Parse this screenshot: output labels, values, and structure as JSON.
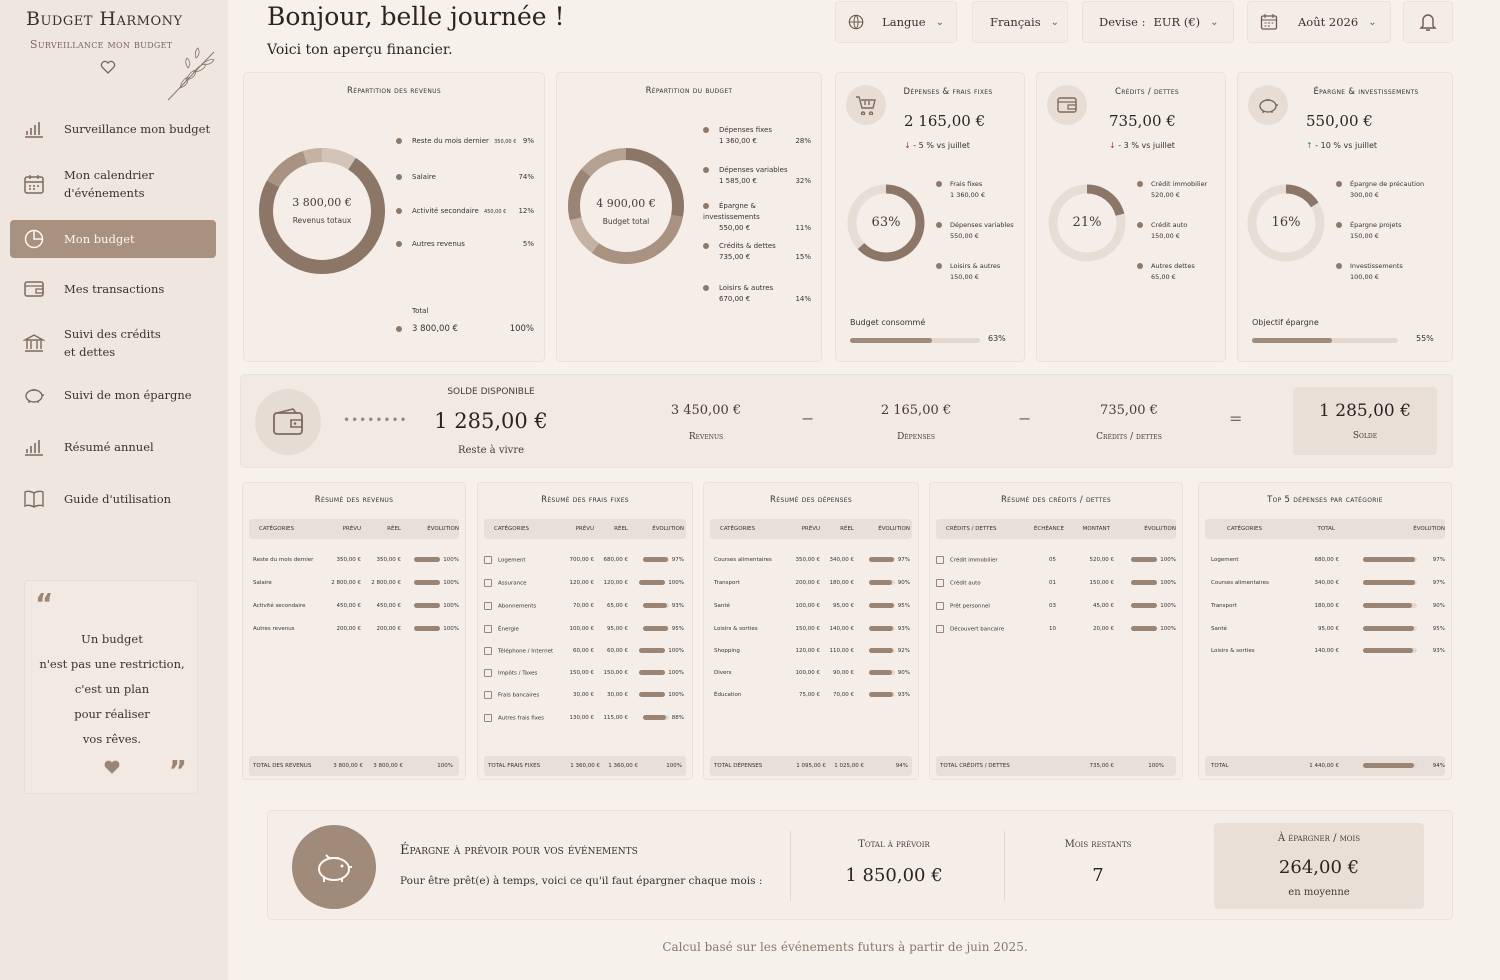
{
  "brand": {
    "title": "Budget Harmony",
    "subtitle": "Surveillance mon budget"
  },
  "nav": [
    {
      "label": "Surveillance mon budget",
      "icon": "chart-bars-icon"
    },
    {
      "label": "Mon calendrier\nd'événements",
      "icon": "calendar-icon"
    },
    {
      "label": "Mon budget",
      "icon": "pie-chart-icon",
      "active": true
    },
    {
      "label": "Mes transactions",
      "icon": "wallet-icon"
    },
    {
      "label": "Suivi des crédits\net dettes",
      "icon": "bank-icon"
    },
    {
      "label": "Suivi de mon épargne",
      "icon": "piggy-bank-icon"
    },
    {
      "label": "Résumé annuel",
      "icon": "chart-bars-icon"
    },
    {
      "label": "Guide d'utilisation",
      "icon": "book-icon"
    }
  ],
  "quote": {
    "lines": [
      "Un budget",
      "n'est pas une restriction,",
      "c'est un plan",
      "pour réaliser",
      "vos rêves."
    ]
  },
  "header": {
    "greeting": "Bonjour, belle journée !",
    "subtitle": "Voici ton aperçu financier.",
    "language": "Langue",
    "locale": "Français",
    "currency_label": "Devise :",
    "currency": "EUR (€)",
    "month": "Août 2026"
  },
  "cards": {
    "revenus": {
      "title": "Répartition des revenus",
      "center_amount": "3 800,00 €",
      "center_label": "Revenus totaux",
      "items": [
        {
          "label": "Reste du mois dernier",
          "amount": "350,00 €",
          "pct": "9%"
        },
        {
          "label": "Salaire",
          "amount": "",
          "pct": "74%"
        },
        {
          "label": "Activité secondaire",
          "amount": "450,00 €",
          "pct": "12%"
        },
        {
          "label": "Autres revenus",
          "amount": "",
          "pct": "5%"
        }
      ],
      "total_label": "Total",
      "total_amount": "3 800,00 €",
      "total_pct": "100%"
    },
    "budget": {
      "title": "Répartition du budget",
      "center_amount": "4 900,00 €",
      "center_label": "Budget total",
      "items": [
        {
          "label": "Dépenses fixes",
          "amount": "1 360,00 €",
          "pct": "28%"
        },
        {
          "label": "Dépenses variables",
          "amount": "1 585,00 €",
          "pct": "32%"
        },
        {
          "label": "Épargne & investissements",
          "amount": "550,00 €",
          "pct": "11%"
        },
        {
          "label": "Crédits & dettes",
          "amount": "735,00 €",
          "pct": "15%"
        },
        {
          "label": "Loisirs & autres",
          "amount": "670,00 €",
          "pct": "14%"
        }
      ]
    },
    "depenses": {
      "title": "Dépenses & frais fixes",
      "amount": "2 165,00 €",
      "delta": "- 5 % vs juillet",
      "donut": "63%",
      "donut_value": 63,
      "items": [
        {
          "label": "Frais fixes",
          "amount": "1 360,00 €"
        },
        {
          "label": "Dépenses variables",
          "amount": "550,00 €"
        },
        {
          "label": "Loisirs & autres",
          "amount": "150,00 €"
        }
      ],
      "progress_label": "Budget consommé",
      "progress_pct": "63%",
      "progress_value": 63
    },
    "credits": {
      "title": "Crédits / dettes",
      "amount": "735,00 €",
      "delta": "- 3 % vs juillet",
      "donut": "21%",
      "donut_value": 21,
      "items": [
        {
          "label": "Crédit immobilier",
          "amount": "520,00 €"
        },
        {
          "label": "Crédit auto",
          "amount": "150,00 €"
        },
        {
          "label": "Autres dettes",
          "amount": "65,00 €"
        }
      ]
    },
    "epargne": {
      "title": "Épargne & investissements",
      "amount": "550,00 €",
      "delta": "- 10 % vs juillet",
      "donut": "16%",
      "donut_value": 16,
      "items": [
        {
          "label": "Épargne de précaution",
          "amount": "300,00 €"
        },
        {
          "label": "Épargne projets",
          "amount": "150,00 €"
        },
        {
          "label": "Investissements",
          "amount": "100,00 €"
        }
      ],
      "progress_label": "Objectif épargne",
      "progress_pct": "55%",
      "progress_value": 55
    }
  },
  "solde": {
    "title": "Solde disponible",
    "amount": "1 285,00 €",
    "label": "Reste à vivre",
    "dots": "••••••••",
    "revenus_amount": "3 450,00 €",
    "revenus_label": "Revenus",
    "depenses_amount": "2 165,00 €",
    "depenses_label": "Dépenses",
    "credits_amount": "735,00 €",
    "credits_label": "Crédits / dettes",
    "minus": "−",
    "equals": "=",
    "result_amount": "1 285,00 €",
    "result_label": "Solde"
  },
  "tables": {
    "revenus": {
      "title": "Résumé des revenus",
      "headers": [
        "Catégories",
        "Prévu",
        "Réel",
        "Évolution"
      ],
      "rows": [
        [
          "Reste du mois dernier",
          "350,00 €",
          "350,00 €",
          "100%"
        ],
        [
          "Salaire",
          "2 800,00 €",
          "2 800,00 €",
          "100%"
        ],
        [
          "Activité secondaire",
          "450,00 €",
          "450,00 €",
          "100%"
        ],
        [
          "Autres revenus",
          "200,00 €",
          "200,00 €",
          "100%"
        ]
      ],
      "total": [
        "Total des revenus",
        "3 800,00 €",
        "3 800,00 €",
        "100%"
      ]
    },
    "frais": {
      "title": "Résumé des frais fixes",
      "headers": [
        "Catégories",
        "Prévu",
        "Réel",
        "Évolution"
      ],
      "rows": [
        [
          "Logement",
          "700,00 €",
          "680,00 €",
          "97%"
        ],
        [
          "Assurance",
          "120,00 €",
          "120,00 €",
          "100%"
        ],
        [
          "Abonnements",
          "70,00 €",
          "65,00 €",
          "93%"
        ],
        [
          "Énergie",
          "100,00 €",
          "95,00 €",
          "95%"
        ],
        [
          "Téléphone / Internet",
          "60,00 €",
          "60,00 €",
          "100%"
        ],
        [
          "Impôts / Taxes",
          "150,00 €",
          "150,00 €",
          "100%"
        ],
        [
          "Frais bancaires",
          "30,00 €",
          "30,00 €",
          "100%"
        ],
        [
          "Autres frais fixes",
          "130,00 €",
          "115,00 €",
          "88%"
        ]
      ],
      "total": [
        "Total frais fixes",
        "1 360,00 €",
        "1 360,00 €",
        "100%"
      ]
    },
    "depenses": {
      "title": "Résumé des dépenses",
      "headers": [
        "Catégories",
        "Prévu",
        "Réel",
        "Évolution"
      ],
      "rows": [
        [
          "Courses alimentaires",
          "350,00 €",
          "340,00 €",
          "97%"
        ],
        [
          "Transport",
          "200,00 €",
          "180,00 €",
          "90%"
        ],
        [
          "Santé",
          "100,00 €",
          "95,00 €",
          "95%"
        ],
        [
          "Loisirs & sorties",
          "150,00 €",
          "140,00 €",
          "93%"
        ],
        [
          "Shopping",
          "120,00 €",
          "110,00 €",
          "92%"
        ],
        [
          "Divers",
          "100,00 €",
          "90,00 €",
          "90%"
        ],
        [
          "Éducation",
          "75,00 €",
          "70,00 €",
          "93%"
        ]
      ],
      "total": [
        "Total dépenses",
        "1 095,00 €",
        "1 025,00 €",
        "94%"
      ]
    },
    "credits": {
      "title": "Résumé des crédits / dettes",
      "headers": [
        "Crédits / dettes",
        "Échéance",
        "Montant",
        "Évolution"
      ],
      "rows": [
        [
          "Crédit immobilier",
          "05",
          "520,00 €",
          "100%"
        ],
        [
          "Crédit auto",
          "01",
          "150,00 €",
          "100%"
        ],
        [
          "Prêt personnel",
          "03",
          "45,00 €",
          "100%"
        ],
        [
          "Découvert bancaire",
          "10",
          "20,00 €",
          "100%"
        ]
      ],
      "total": [
        "Total crédits / dettes",
        "",
        "735,00 €",
        "100%"
      ]
    },
    "top5": {
      "title": "Top 5 dépenses par catégorie",
      "headers": [
        "Catégories",
        "Total",
        "",
        "Évolution"
      ],
      "rows": [
        [
          "Logement",
          "680,00 €",
          "",
          "97%"
        ],
        [
          "Courses alimentaires",
          "340,00 €",
          "",
          "97%"
        ],
        [
          "Transport",
          "180,00 €",
          "",
          "90%"
        ],
        [
          "Santé",
          "95,00 €",
          "",
          "95%"
        ],
        [
          "Loisirs & sorties",
          "140,00 €",
          "",
          "93%"
        ]
      ],
      "total": [
        "Total",
        "1 440,00 €",
        "",
        "94%"
      ]
    }
  },
  "events": {
    "title": "Épargne à prévoir pour vos événements",
    "subtitle": "Pour être prêt(e) à temps, voici ce qu'il faut épargner chaque mois :",
    "total_label": "Total à prévoir",
    "total_amount": "1 850,00 €",
    "months_label": "Mois restants",
    "months": "7",
    "monthly_label": "À épargner / mois",
    "monthly_amount": "264,00 €",
    "monthly_sub": "en moyenne"
  },
  "footer": "Calcul basé sur les événements futurs à partir de juin 2025.",
  "colors": {
    "accent": "#a9917f",
    "donut_fill": "#8b7667",
    "donut_track": "#e6ddd5",
    "bg": "#f7f1ec"
  }
}
